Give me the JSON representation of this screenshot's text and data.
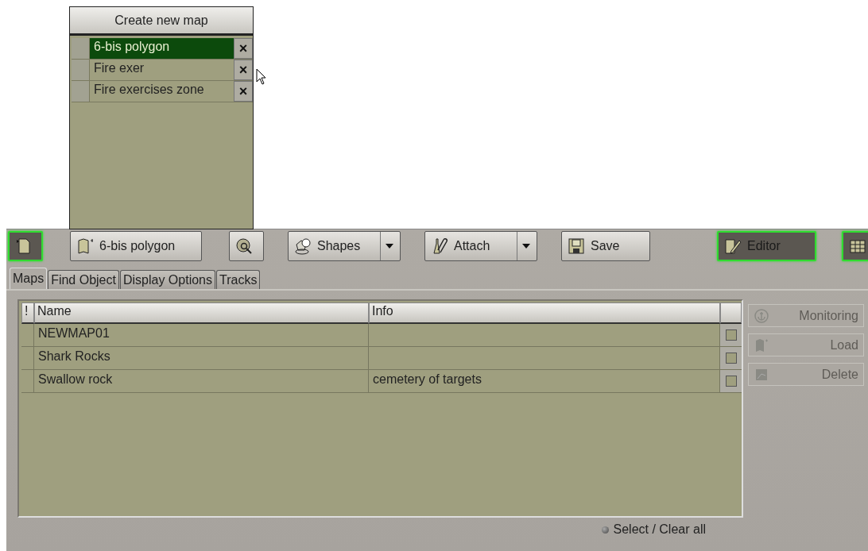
{
  "popup": {
    "create_button": "Create new map",
    "maps": [
      {
        "name": "6-bis polygon",
        "selected": true,
        "delete": "×"
      },
      {
        "name": "Fire exer",
        "selected": false,
        "delete": "×"
      },
      {
        "name": "Fire exercises zone",
        "selected": false,
        "delete": "×"
      }
    ]
  },
  "toolbar": [
    {
      "kind": "icon",
      "active": true
    },
    {
      "kind": "text",
      "label": "6-bis polygon",
      "active": false
    },
    {
      "kind": "icon",
      "active": false
    },
    {
      "kind": "dropdown",
      "label": "Shapes",
      "active": false
    },
    {
      "kind": "dropdown",
      "label": "Attach",
      "active": false
    },
    {
      "kind": "text",
      "label": "Save",
      "active": false
    },
    {
      "kind": "text",
      "label": "Editor",
      "active": true
    },
    {
      "kind": "icon",
      "active": true
    }
  ],
  "tabs": [
    {
      "label": "Maps",
      "selected": true
    },
    {
      "label": "Find Object",
      "selected": false
    },
    {
      "label": "Display Options",
      "selected": false
    },
    {
      "label": "Tracks",
      "selected": false
    }
  ],
  "table": {
    "columns": [
      "!",
      "Name",
      "Info"
    ],
    "rows": [
      {
        "name": "NEWMAP01",
        "info": "",
        "checked": false
      },
      {
        "name": "Shark Rocks",
        "info": "",
        "checked": false
      },
      {
        "name": "Swallow rock",
        "info": "cemetery of targets",
        "checked": false
      }
    ]
  },
  "side_buttons": [
    {
      "label": "Monitoring",
      "disabled": true
    },
    {
      "label": "Load",
      "disabled": true
    },
    {
      "label": "Delete",
      "disabled": true
    }
  ],
  "footer": {
    "label": "Select / Clear all",
    "selected": false
  }
}
